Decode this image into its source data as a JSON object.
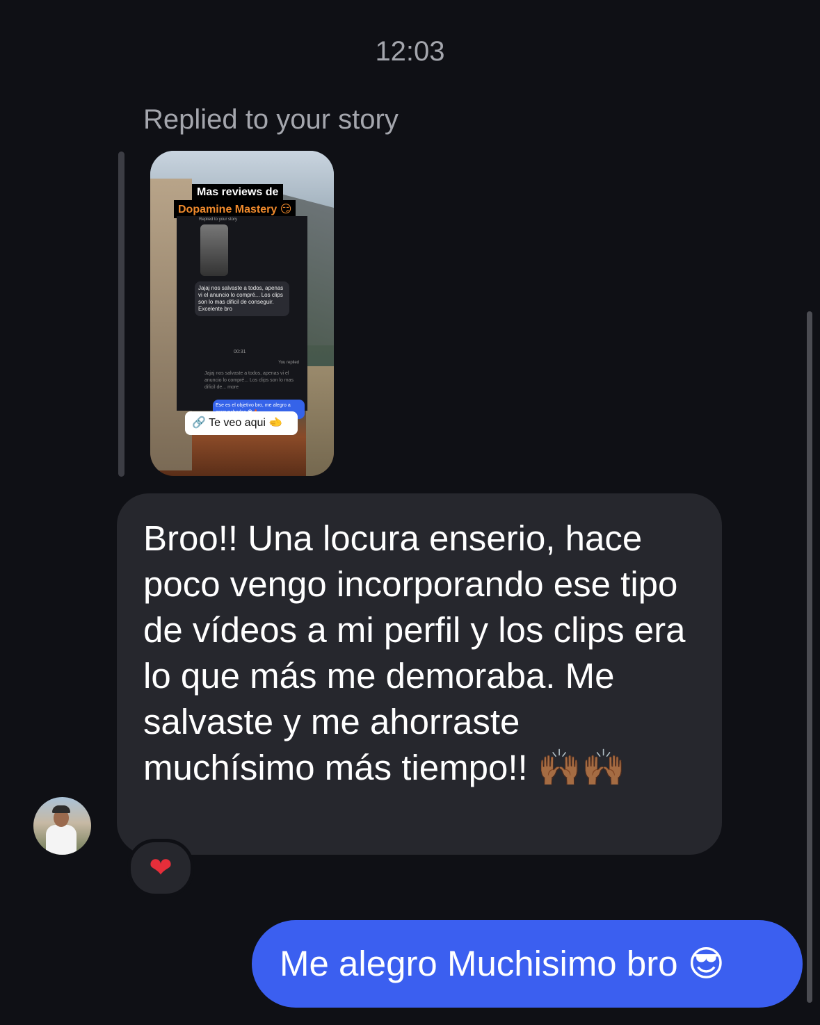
{
  "thread": {
    "timestamp": "12:03",
    "reply_context": "Replied to your story"
  },
  "story_preview": {
    "title_line1": "Mas reviews de",
    "title_line2": "Dopamine Mastery 😏",
    "embedded_label": "Replied to your story",
    "embedded_message": "Jajaj nos salvaste a todos, apenas vi el anuncio lo compré... Los clips son lo mas dificil de conseguir. Excelente bro",
    "embedded_time": "00:31",
    "embedded_you_replied": "You replied",
    "embedded_quote": "Jajaj nos salvaste a todos, apenas vi el anuncio lo compré... Los clips son lo mas dificil de... more",
    "embedded_reply": "Ese es el objetivo bro, me alegro a aprovecharlos 😎🔥",
    "link_icon": "link-icon",
    "link_label": "Te veo aqui 🫲"
  },
  "messages": {
    "incoming_text": "Broo!! Una locura enserio, hace poco vengo incorporando ese tipo de vídeos a mi perfil y los clips era lo que más me demoraba. Me salvaste y me ahorraste muchísimo más tiempo!! 🙌🏾🙌🏾",
    "incoming_reaction": "❤",
    "outgoing_text": "Me alegro Muchisimo bro 😎"
  },
  "colors": {
    "background": "#0f1015",
    "incoming_bubble": "#26272d",
    "outgoing_bubble": "#3b5ff0",
    "muted_text": "#a4a6ad",
    "reaction_heart": "#e62e3a"
  }
}
